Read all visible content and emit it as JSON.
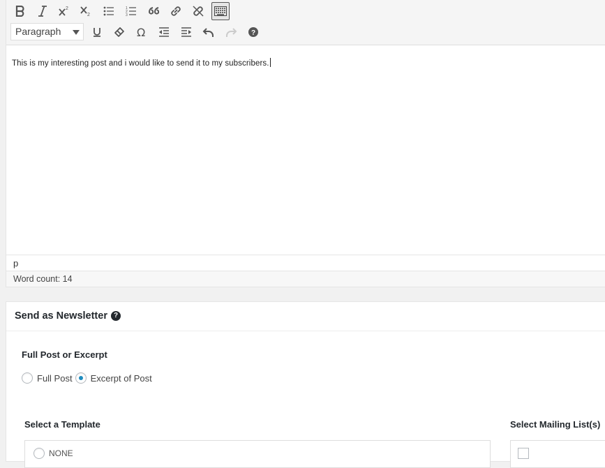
{
  "toolbar": {
    "row1": [
      {
        "name": "bold-icon",
        "label": "B"
      },
      {
        "name": "italic-icon",
        "label": "I"
      },
      {
        "name": "superscript-icon",
        "label": "x²"
      },
      {
        "name": "subscript-icon",
        "label": "x₂"
      },
      {
        "name": "bulleted-list-icon",
        "label": ""
      },
      {
        "name": "numbered-list-icon",
        "label": ""
      },
      {
        "name": "blockquote-icon",
        "label": ""
      },
      {
        "name": "insert-link-icon",
        "label": ""
      },
      {
        "name": "remove-link-icon",
        "label": ""
      },
      {
        "name": "toolbar-toggle-icon",
        "label": ""
      }
    ],
    "row2": [
      {
        "name": "underline-icon",
        "label": "U"
      },
      {
        "name": "clear-formatting-icon",
        "label": ""
      },
      {
        "name": "special-character-icon",
        "label": "Ω"
      },
      {
        "name": "outdent-icon",
        "label": ""
      },
      {
        "name": "indent-icon",
        "label": ""
      },
      {
        "name": "undo-icon",
        "label": ""
      },
      {
        "name": "redo-icon",
        "label": ""
      },
      {
        "name": "help-icon",
        "label": "?"
      }
    ],
    "format_select": {
      "value": "Paragraph"
    }
  },
  "editor": {
    "content": "This is my interesting post and i would like to send it to my subscribers.",
    "path": "p",
    "word_count_label": "Word count: 14"
  },
  "newsletter": {
    "title": "Send as Newsletter",
    "help_glyph": "?",
    "full_post_section": {
      "label": "Full Post or Excerpt",
      "options": [
        {
          "label": "Full Post",
          "checked": false
        },
        {
          "label": "Excerpt of Post",
          "checked": true
        }
      ]
    },
    "template_section": {
      "label": "Select a Template",
      "first_option": "NONE"
    },
    "mailing_list_section": {
      "label": "Select Mailing List(s)"
    }
  },
  "colors": {
    "accent": "#1e8cbe",
    "toolbar_bg": "#f5f5f5",
    "page_bg": "#f1f1f1"
  }
}
